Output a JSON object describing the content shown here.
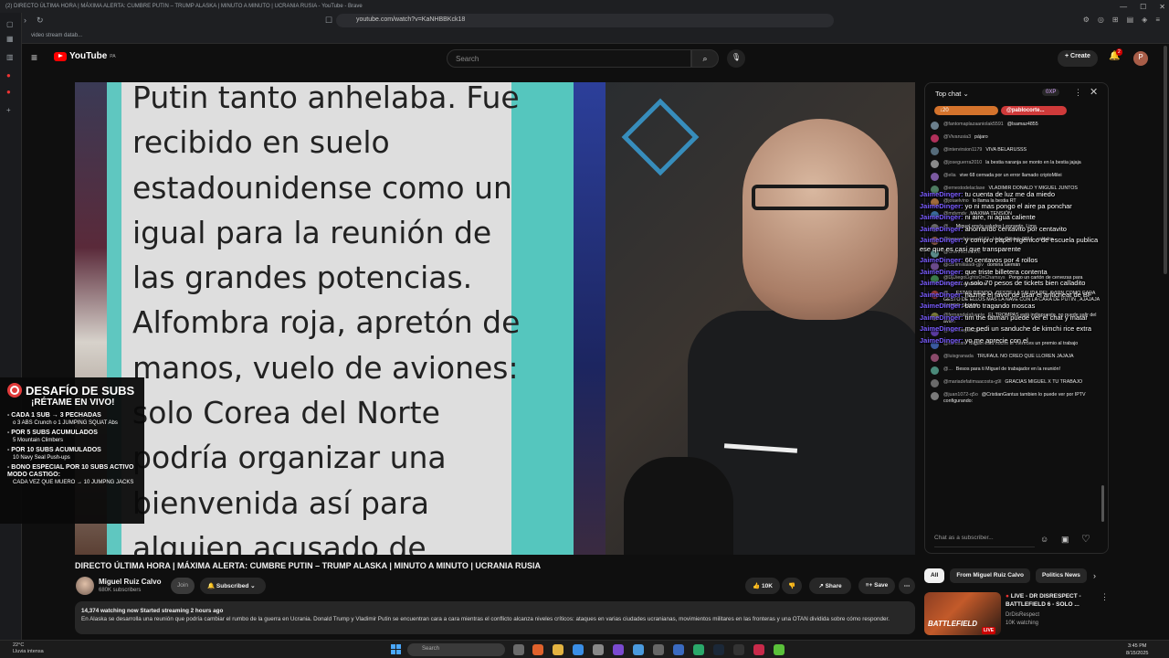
{
  "browser": {
    "window_title": "(2) DIRECTO ÚLTIMA HORA | MÁXIMA ALERTA: CUMBRE PUTIN – TRUMP ALASKA | MINUTO A MINUTO | UCRANIA RUSIA - YouTube - Brave",
    "url": "youtube.com/watch?v=KaNHBBKck18",
    "bookmark": "video stream datab..."
  },
  "youtube": {
    "logo_text": "YouTube",
    "logo_region": "PA",
    "search_placeholder": "Search",
    "create_label": "Create",
    "notification_count": "2",
    "avatar_letter": "P"
  },
  "video": {
    "lines": [
      "Putin tanto anhelaba. Fue",
      "recibido en suelo",
      "estadounidense como un",
      "igual para la reunión de",
      "las grandes potencias.",
      "Alfombra roja, apretón de",
      "manos, vuelo de aviones:",
      "solo Corea del Norte",
      "podría organizar una",
      "bienvenida así para",
      "alguien acusado de"
    ]
  },
  "subs_challenge": {
    "title": "DESAFÍO DE SUBS",
    "subtitle": "¡RÉTAME EN VIVO!",
    "rules": [
      {
        "main": "- CADA 1 SUB → 3 PECHADAS",
        "detail": "o 3 ABS Crunch o 1 JUMPING SQUAT Abs"
      },
      {
        "main": "- POR 5 SUBS ACUMULADOS",
        "detail": "5 Mountain Climbers"
      },
      {
        "main": "- POR 10 SUBS ACUMULADOS",
        "detail": "10 Navy Seal Push-ups"
      },
      {
        "main": "- BONO ESPECIAL POR 10 SUBS ACTIVO MODO CASTIGO:",
        "detail": "CADA VEZ QUE MUERO → 10 JUMPNG JACKS"
      }
    ]
  },
  "meta": {
    "title": "DIRECTO ÚLTIMA HORA | MÁXIMA ALERTA: CUMBRE PUTIN – TRUMP ALASKA | MINUTO A MINUTO | UCRANIA RUSIA",
    "channel": "Miguel Ruiz Calvo",
    "subscribers": "680K subscribers",
    "join": "Join",
    "subscribed": "Subscribed",
    "likes": "10K",
    "share": "Share",
    "save": "Save",
    "watching": "14,374 watching now",
    "started": "Started streaming 2 hours ago",
    "description": "En Alaska se desarrolla una reunión que podría cambiar el rumbo de la guerra en Ucrania. Donald Trump y Vladimir Putin se encuentran cara a cara mientras el conflicto alcanza niveles críticos: ataques en varias ciudades ucranianas, movimientos militares en las fronteras y una OTAN dividida sobre cómo responder."
  },
  "chat": {
    "mode": "Top chat",
    "xp": "0XP",
    "pin1": "↓20",
    "pin2": "@pablocorte...",
    "input_placeholder": "Chat as a subscriber...",
    "messages": [
      {
        "author": "@fantomaplazaaniolak5591",
        "text": "@lsamaz4855",
        "color": "#6b7f8c"
      },
      {
        "author": "@Vivarusia3",
        "text": "pájaro",
        "color": "#b0305a"
      },
      {
        "author": "@intervirsion1179",
        "text": "VIVA BELARUSSS",
        "color": "#556b7a"
      },
      {
        "author": "@joseguerra2010",
        "text": "la bestia naranja se monto en la bestia jajaja",
        "color": "#8a8a8a"
      },
      {
        "author": "@elia",
        "text": "vive 68 cernada por un error llamado criptoMilei",
        "color": "#7b5aa0"
      },
      {
        "author": "@ernestodelaclase",
        "text": "VLADIMIR DONALD Y MIGUEL JUNTOS",
        "color": "#4e7b60"
      },
      {
        "author": "@jotaelvino",
        "text": "lo llama la bestia RT",
        "color": "#a06a3a"
      },
      {
        "author": "@mdymdv",
        "text": "MAXIMA TENSIÓN",
        "color": "#3a6a9a"
      },
      {
        "author": "@...",
        "text": "Miguel envía saludos Leonardo, Lima",
        "color": "#6a6a6a"
      },
      {
        "author": "@teresadejesus6182",
        "text": "Hola @juanc.9814 , saludos.",
        "color": "#8a5a4a"
      },
      {
        "author": "@CrenniCreativo",
        "text": "",
        "color": "#5a8a8a"
      },
      {
        "author": "@carlimillaladi-gjlv",
        "text": "domina alemán",
        "color": "#6a4a8a"
      },
      {
        "author": "@DjDiegoLightsOnChamsys",
        "text": "Pongo un cartón de cervezas para empezar a amenizar",
        "color": "#3a7a4a"
      },
      {
        "author": "@...",
        "text": "ESTAR RIENDO , DESDE LA SALIDA DEL AVION COMO CADA GESTO DE ELLOS MAS LA NAVE CON LA CARA DE PUTIN , AJAJAJA SUPER JAJAJA",
        "color": "#9a3a3a"
      },
      {
        "author": "@fernandelafuente",
        "text": "EL TROMPAS está indiapuesto, no puede salir del avión",
        "color": "#7a7a3a"
      },
      {
        "author": "@hilariotejada2047",
        "text": "",
        "color": "#5a3aa0"
      },
      {
        "author": "@esteban",
        "text": "Miguel está noche te mereces un premio al trabajo",
        "color": "#3a5aa0"
      },
      {
        "author": "@luisgranada",
        "text": "TRUFAUL NO CREO QUE LLOREN JAJAJA",
        "color": "#8a4a6a"
      },
      {
        "author": "@...",
        "text": "Besos para ti Miguel de trabajador en la reunión!",
        "color": "#4a8a7a"
      },
      {
        "author": "@mariadefatimaacosta-g9l",
        "text": "GRACIAS MIGUEL X TU TRABAJO",
        "color": "#6a6a6a"
      },
      {
        "author": "@juan1072-q5o",
        "text": "@CristianGantus tambien lo puede ver por IPTV configurando:",
        "color": "#7a7a7a"
      }
    ],
    "overlay": [
      {
        "user": "JaimeDinger:",
        "text": "tu cuenta de luz me da miedo"
      },
      {
        "user": "JaimeDinger:",
        "text": "yo ni mas pongo el aire pa ponchar"
      },
      {
        "user": "JaimeDinger:",
        "text": "ni aire, ni agua caliente"
      },
      {
        "user": "JaimeDinger:",
        "text": "ahorrando centavito por centavito"
      },
      {
        "user": "JaimeDinger:",
        "text": "y compro papel higenico de escuela publica ese que es casi que transparente"
      },
      {
        "user": "JaimeDinger:",
        "text": "60 centavos por 4 rollos"
      },
      {
        "user": "JaimeDinger:",
        "text": "que triste billetera contenta"
      },
      {
        "user": "JaimeDinger:",
        "text": "y solo 70 pesos de tickets bien calladito"
      },
      {
        "user": "JaimeDinger:",
        "text": "hazme el favor de usar el anticheat de BF"
      },
      {
        "user": "JaimeDinger:",
        "text": "batro tragando moscas"
      },
      {
        "user": "JaimeDinger:",
        "text": "tim the tatman puede ver el chat y matar"
      },
      {
        "user": "JaimeDinger:",
        "text": "me pedi un sanduche de kimchi rice extra"
      },
      {
        "user": "JaimeDinger:",
        "text": "yo me aprecie con el"
      }
    ]
  },
  "recommendations": {
    "chips": [
      "All",
      "From Miguel Ruiz Calvo",
      "Politics News"
    ],
    "item": {
      "title": "LIVE - DR DISRESPECT - BATTLEFIELD 6 - SOLO ...",
      "channel": "DrDisRespect",
      "viewers": "10K watching",
      "thumb_text": "BATTLEFIELD",
      "live_badge": "LIVE"
    }
  },
  "taskbar": {
    "temp": "22°C",
    "weather": "Lluvia intensa",
    "search_placeholder": "Search",
    "time": "3:45 PM",
    "date": "8/15/2025"
  }
}
